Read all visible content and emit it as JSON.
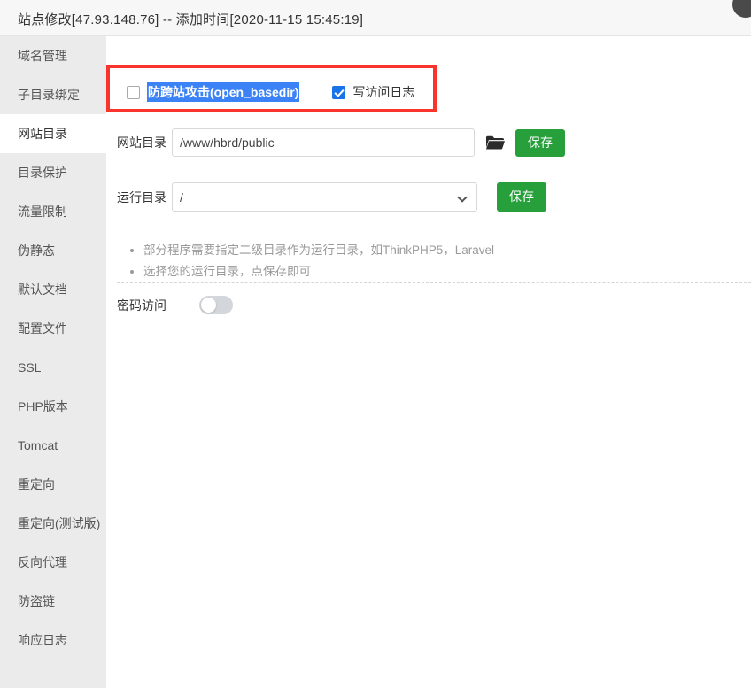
{
  "window": {
    "title": "站点修改[47.93.148.76] -- 添加时间[2020-11-15 15:45:19]"
  },
  "sidebar": {
    "items": [
      {
        "label": "域名管理",
        "active": false
      },
      {
        "label": "子目录绑定",
        "active": false
      },
      {
        "label": "网站目录",
        "active": true
      },
      {
        "label": "目录保护",
        "active": false
      },
      {
        "label": "流量限制",
        "active": false
      },
      {
        "label": "伪静态",
        "active": false
      },
      {
        "label": "默认文档",
        "active": false
      },
      {
        "label": "配置文件",
        "active": false
      },
      {
        "label": "SSL",
        "active": false
      },
      {
        "label": "PHP版本",
        "active": false
      },
      {
        "label": "Tomcat",
        "active": false
      },
      {
        "label": "重定向",
        "active": false
      },
      {
        "label": "重定向(测试版)",
        "active": false
      },
      {
        "label": "反向代理",
        "active": false
      },
      {
        "label": "防盗链",
        "active": false
      },
      {
        "label": "响应日志",
        "active": false
      }
    ]
  },
  "options": {
    "anti_crosssite_label": "防跨站攻击(open_basedir)",
    "anti_crosssite_checked": false,
    "anti_crosssite_selected": true,
    "access_log_label": "写访问日志",
    "access_log_checked": true
  },
  "site_dir": {
    "label": "网站目录",
    "value": "/www/hbrd/public",
    "placeholder": "/www/hbrd/public",
    "browse_icon": "folder-icon",
    "save_label": "保存"
  },
  "run_dir": {
    "label": "运行目录",
    "value": "/",
    "caret_icon": "chevron-down-icon",
    "save_label": "保存"
  },
  "hints": [
    "部分程序需要指定二级目录作为运行目录，如ThinkPHP5，Laravel",
    "选择您的运行目录，点保存即可"
  ],
  "password_access": {
    "label": "密码访问",
    "enabled": false
  },
  "colors": {
    "accent_green": "#27a03c",
    "checkbox_blue": "#1a73e8",
    "selection_blue": "#3b82f6",
    "annotation_red": "#f9342c",
    "sidebar_bg": "#ebebeb",
    "titlebar_bg": "#f7f7f7"
  }
}
